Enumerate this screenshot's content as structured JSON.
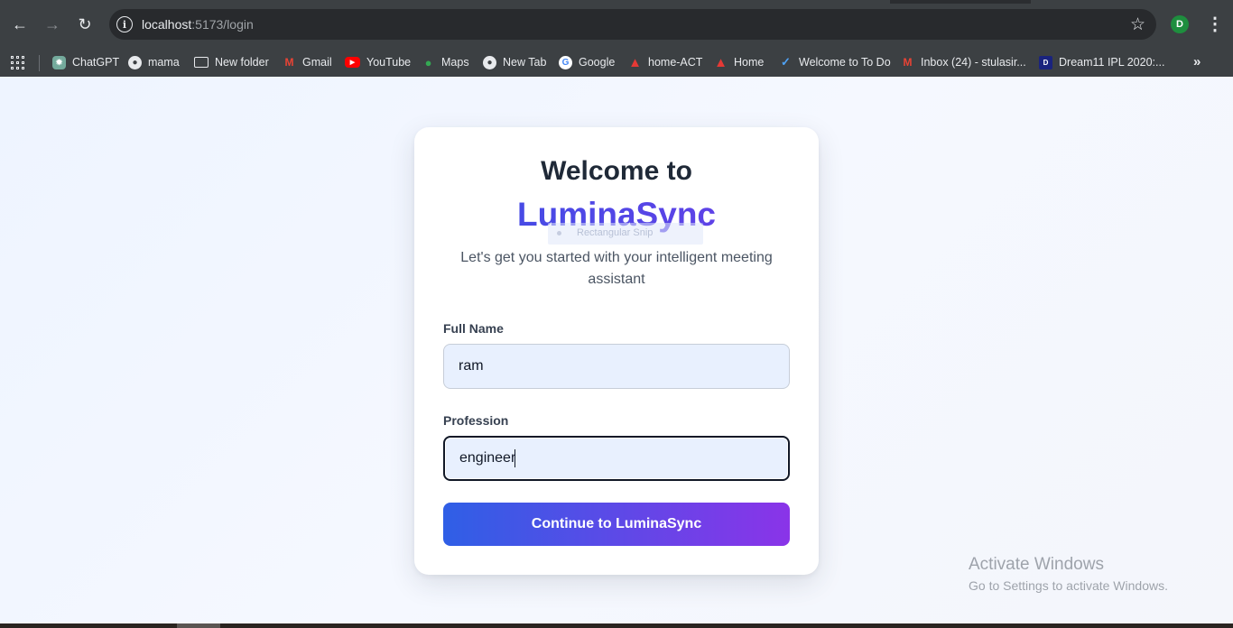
{
  "browser": {
    "url_host": "localhost",
    "url_path": ":5173/login",
    "profile_initial": "D",
    "bookmarks": [
      {
        "label": "ChatGPT",
        "icon": "chatgpt-icon"
      },
      {
        "label": "mama",
        "icon": "globe-icon"
      },
      {
        "label": "New folder",
        "icon": "folder-icon"
      },
      {
        "label": "Gmail",
        "icon": "gmail-icon"
      },
      {
        "label": "YouTube",
        "icon": "youtube-icon"
      },
      {
        "label": "Maps",
        "icon": "maps-icon"
      },
      {
        "label": "New Tab",
        "icon": "globe-icon"
      },
      {
        "label": "Google",
        "icon": "google-icon"
      },
      {
        "label": "home-ACT",
        "icon": "act-icon"
      },
      {
        "label": "Home",
        "icon": "act-icon"
      },
      {
        "label": "Welcome to To Do",
        "icon": "todo-icon"
      },
      {
        "label": "Inbox (24) - stulasir...",
        "icon": "gmail-icon"
      },
      {
        "label": "Dream11 IPL 2020:...",
        "icon": "dream11-icon"
      }
    ]
  },
  "login": {
    "title_line1": "Welcome to",
    "title_line2": "LuminaSync",
    "subtitle": "Let's get you started with your intelligent meeting assistant",
    "overlay_text": "Rectangular Snip",
    "full_name": {
      "label": "Full Name",
      "value": "ram"
    },
    "profession": {
      "label": "Profession",
      "value": "engineer"
    },
    "submit_label": "Continue to LuminaSync"
  },
  "watermark": {
    "line1": "Activate Windows",
    "line2": "Go to Settings to activate Windows."
  },
  "colors": {
    "brand_gradient_start": "#2f5fe6",
    "brand_gradient_end": "#8a34e8",
    "input_bg": "#e8f0fe",
    "page_bg": "#eef4ff"
  }
}
